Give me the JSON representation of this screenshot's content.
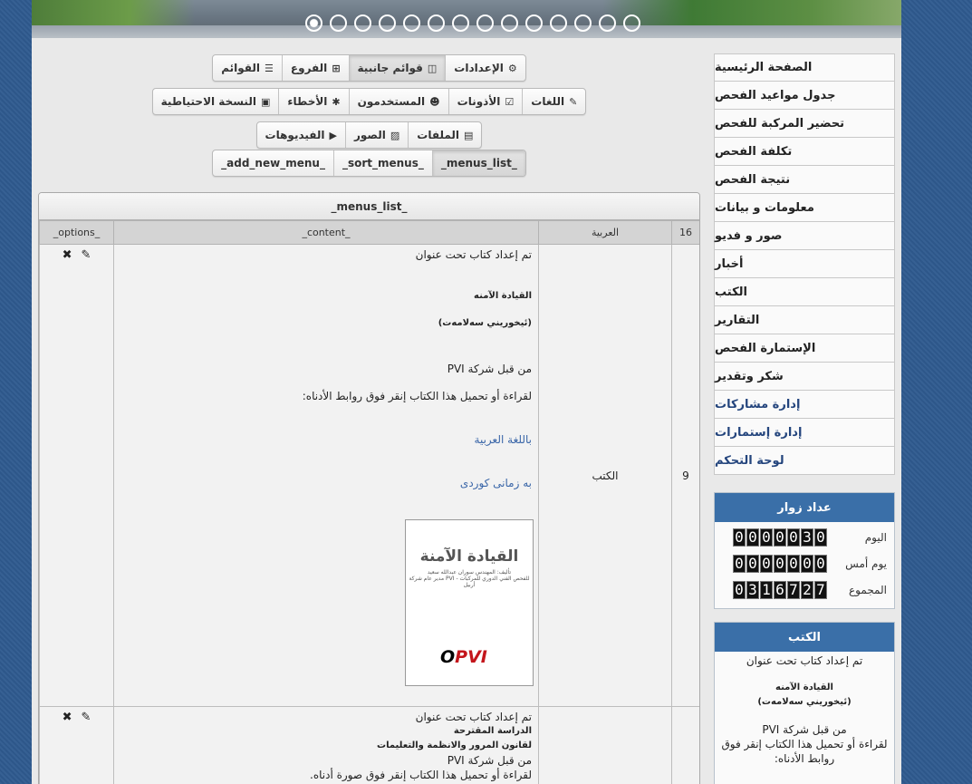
{
  "slider": {
    "dot_count": 14,
    "active_index": 0
  },
  "toolbar": {
    "row1": [
      {
        "label": "الإعدادات",
        "icon": "gear-icon",
        "glyph": "⚙",
        "active": false
      },
      {
        "label": "قوائم جانبية",
        "icon": "sidebar-icon",
        "glyph": "◫",
        "active": true
      },
      {
        "label": "الفروع",
        "icon": "sitemap-icon",
        "glyph": "⊞",
        "active": false
      },
      {
        "label": "القوائم",
        "icon": "list-icon",
        "glyph": "☰",
        "active": false
      }
    ],
    "row2": [
      {
        "label": "اللغات",
        "icon": "language-icon",
        "glyph": "✎",
        "active": false
      },
      {
        "label": "الأذونات",
        "icon": "checkbox-icon",
        "glyph": "☑",
        "active": false
      },
      {
        "label": "المستخدمون",
        "icon": "users-icon",
        "glyph": "☻",
        "active": false
      },
      {
        "label": "الأخطاء",
        "icon": "bug-icon",
        "glyph": "✱",
        "active": false
      },
      {
        "label": "النسخة الاحتياطية",
        "icon": "briefcase-icon",
        "glyph": "▣",
        "active": false
      }
    ],
    "row3": [
      {
        "label": "الملفات",
        "icon": "file-icon",
        "glyph": "▤",
        "active": false
      },
      {
        "label": "الصور",
        "icon": "image-icon",
        "glyph": "▨",
        "active": false
      },
      {
        "label": "الفيديوهات",
        "icon": "play-icon",
        "glyph": "▶",
        "active": false
      }
    ],
    "row4": [
      {
        "label": "_menus_list_",
        "active": true
      },
      {
        "label": "_sort_menus_",
        "active": false
      },
      {
        "label": "_add_new_menu_",
        "active": false
      }
    ]
  },
  "table": {
    "title": "_menus_list_",
    "headers": {
      "count": "16",
      "language": "العربية",
      "content": "_content_",
      "options": "_options_"
    },
    "rows": [
      {
        "num": "9",
        "section": "الكتب",
        "lines": [
          {
            "text": "تم إعداد كتاب تحت عنوان",
            "style": "normal",
            "gap": 0
          },
          {
            "text": "القيادة الآمنه",
            "style": "bold",
            "gap": 30
          },
          {
            "text": "(ئيخوريني سەلامەت)",
            "style": "bold",
            "gap": 14
          },
          {
            "text": "من قبل شركة PVI",
            "style": "normal",
            "gap": 34
          },
          {
            "text": "لقراءة أو تحميل هذا الكتاب إنقر فوق روابط الأدناه:",
            "style": "normal",
            "gap": 14
          },
          {
            "text": "باللغة العربية",
            "style": "link",
            "gap": 32
          },
          {
            "text": "به زمانى كوردى",
            "style": "link",
            "gap": 32
          }
        ],
        "book": {
          "title": "القيادة الآمنة",
          "subtitle": "تأليف: المهندس سوران عبدالله سعيد\nمدير عام شركة PVI للفحص الفني الدوري للمركبات - أربيل",
          "logo_red": "PVI",
          "logo_black": "O"
        }
      },
      {
        "num": "",
        "section": "",
        "lines": [
          {
            "text": "تم إعداد كتاب تحت عنوان",
            "style": "normal",
            "gap": 0
          },
          {
            "text": "الدراسة المقترحة",
            "style": "bold",
            "gap": 0
          },
          {
            "text": "لقانون المرور والانظمة والتعليمات",
            "style": "bold",
            "gap": 0
          },
          {
            "text": "من قبل شركة PVI",
            "style": "normal",
            "gap": 0
          },
          {
            "text": "لقراءة أو تحميل هذا الكتاب إنقر فوق صورة أدناه.",
            "style": "normal",
            "gap": 0
          }
        ]
      }
    ]
  },
  "sidebar": {
    "items": [
      {
        "label": "الصفحة الرئيسية",
        "blue": false
      },
      {
        "label": "جدول مواعيد الفحص",
        "blue": false
      },
      {
        "label": "تحضير المركبة للفحص",
        "blue": false
      },
      {
        "label": "تكلفة الفحص",
        "blue": false
      },
      {
        "label": "نتيجة الفحص",
        "blue": false
      },
      {
        "label": "معلومات و بيانات",
        "blue": false
      },
      {
        "label": "صور و فديو",
        "blue": false
      },
      {
        "label": "أخبار",
        "blue": false
      },
      {
        "label": "الكتب",
        "blue": false
      },
      {
        "label": "التقارير",
        "blue": false
      },
      {
        "label": "الإستمارة الفحص",
        "blue": false
      },
      {
        "label": "شكر وتقدير",
        "blue": false
      },
      {
        "label": "إدارة مشاركات",
        "blue": true
      },
      {
        "label": "إدارة إستمارات",
        "blue": true
      },
      {
        "label": "لوحة التحكم",
        "blue": true
      }
    ]
  },
  "visitors": {
    "title": "عداد زوار",
    "rows": [
      {
        "label": "اليوم",
        "value": "0000030"
      },
      {
        "label": "يوم أمس",
        "value": "0000000"
      },
      {
        "label": "المجموع",
        "value": "0316727"
      }
    ]
  },
  "books_panel": {
    "title": "الكتب",
    "lines": [
      {
        "text": "تم إعداد كتاب تحت عنوان",
        "style": "normal",
        "gap": 0
      },
      {
        "text": "القيادة الآمنه",
        "style": "bold",
        "gap": 14
      },
      {
        "text": "(ئيخوريني سەلامەت)",
        "style": "bold",
        "gap": 0
      },
      {
        "text": "من قبل شركة PVI",
        "style": "normal",
        "gap": 14
      },
      {
        "text": "لقراءة أو تحميل هذا الكتاب إنقر فوق روابط الأدناه:",
        "style": "normal",
        "gap": 0
      }
    ]
  },
  "colors": {
    "background": "#2f5a8f",
    "panel_header": "#3a6fa8",
    "link": "#3a66a8"
  }
}
